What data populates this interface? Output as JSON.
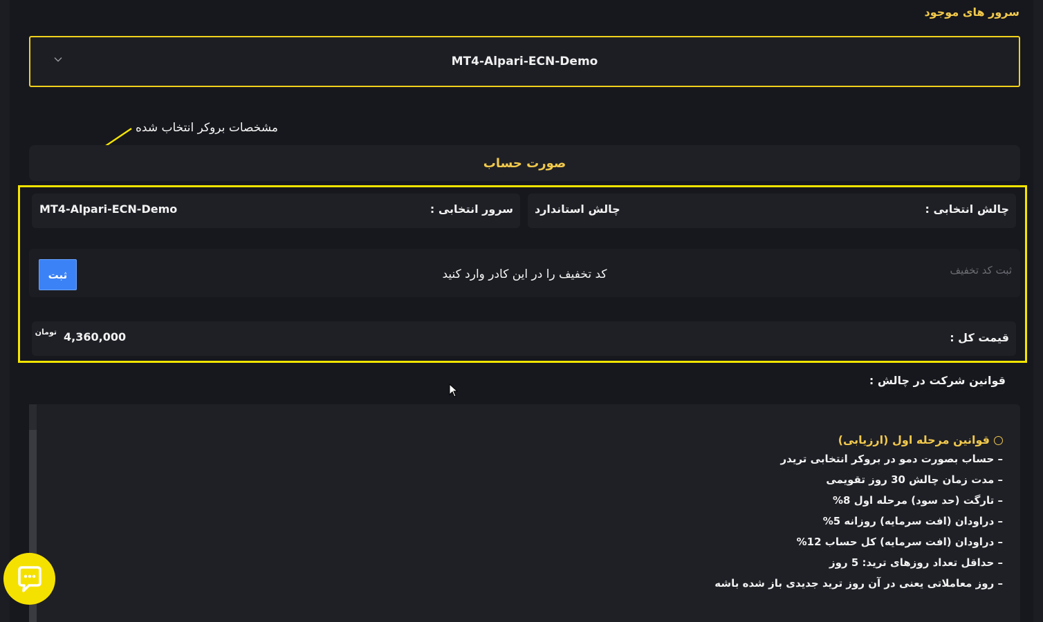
{
  "servers": {
    "label": "سرور های موجود",
    "selected": "MT4-Alpari-ECN-Demo"
  },
  "annotation": {
    "text": "مشخصات بروکر انتخاب شده"
  },
  "invoice": {
    "title": "صورت حساب",
    "challenge_label": "چالش انتخابی :",
    "challenge_value": "چالش استاندارد",
    "server_label": "سرور انتخابی :",
    "server_value": "MT4-Alpari-ECN-Demo",
    "discount_placeholder": "ثبت کد تخفیف",
    "discount_hint": "کد تخفیف را در این کادر وارد کنید",
    "discount_button": "ثبت",
    "total_label": "قیمت کل :",
    "total_value": "4,360,000",
    "currency": "تومان"
  },
  "rules": {
    "label": "قوانین شرکت در چالش :",
    "section_title": "قوانین مرحله اول (ارزیابی)",
    "items": [
      "– حساب بصورت دمو در بروکر انتخابی تریدر",
      "– مدت زمان چالش 30 روز تقویمی",
      "– تارگت (حد سود) مرحله اول 8%",
      "– دراودان (افت سرمایه) روزانه 5%",
      "– دراودان (افت سرمایه) کل حساب 12%",
      "– حداقل تعداد روزهای ترید: 5 روز",
      "– روز معاملاتی یعنی در آن روز ترید جدیدی باز شده باشه"
    ]
  },
  "colors": {
    "accent": "#f2c94c",
    "highlight": "#f5e500",
    "button": "#3b82f6",
    "background": "#17181d"
  }
}
